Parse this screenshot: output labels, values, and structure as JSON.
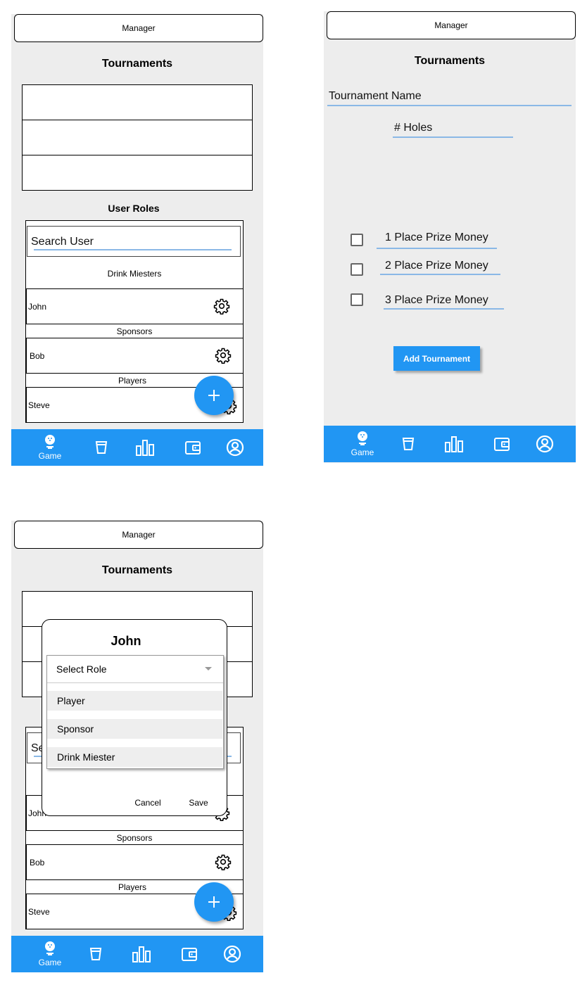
{
  "header": {
    "title": "Manager"
  },
  "page_title": "Tournaments",
  "user_roles": {
    "title": "User Roles",
    "search_placeholder": "Search User",
    "groups": [
      {
        "label": "Drink Miesters",
        "users": [
          "John"
        ]
      },
      {
        "label": "Sponsors",
        "users": [
          "Bob"
        ]
      },
      {
        "label": "Players",
        "users": [
          "Steve"
        ]
      }
    ]
  },
  "nav": {
    "items": [
      {
        "icon": "golf-ball-icon",
        "label": "Game"
      },
      {
        "icon": "cup-icon",
        "label": ""
      },
      {
        "icon": "bar-chart-icon",
        "label": ""
      },
      {
        "icon": "wallet-icon",
        "label": ""
      },
      {
        "icon": "account-icon",
        "label": ""
      }
    ]
  },
  "form": {
    "tournament_name": "Tournament Name",
    "holes": "# Holes",
    "prizes": [
      "1 Place Prize Money",
      "2 Place Prize Money",
      "3 Place Prize Money"
    ],
    "submit": "Add Tournament"
  },
  "dialog": {
    "title": "John",
    "select_placeholder": "Select Role",
    "options": [
      "Player",
      "Sponsor",
      "Drink Miester"
    ],
    "cancel": "Cancel",
    "save": "Save"
  },
  "colors": {
    "accent": "#2196f3",
    "underline": "#8ab8e6",
    "phone_bg": "#ededed"
  }
}
